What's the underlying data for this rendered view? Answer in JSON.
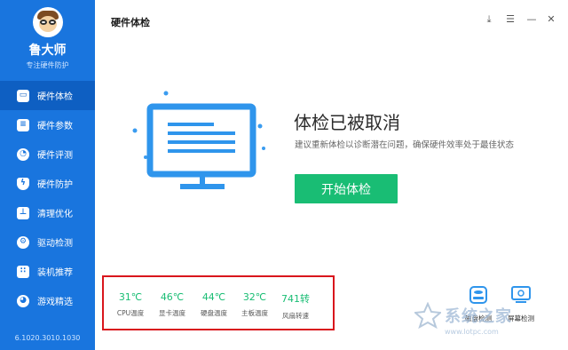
{
  "app": {
    "brand_name": "鲁大师",
    "brand_slogan": "专注硬件防护",
    "version": "6.1020.3010.1030"
  },
  "sidebar": {
    "items": [
      {
        "label": "硬件体检",
        "icon": "monitor-icon",
        "active": true
      },
      {
        "label": "硬件参数",
        "icon": "list-icon"
      },
      {
        "label": "硬件评测",
        "icon": "gauge-icon"
      },
      {
        "label": "硬件防护",
        "icon": "shield-icon"
      },
      {
        "label": "清理优化",
        "icon": "broom-icon"
      },
      {
        "label": "驱动检测",
        "icon": "gear-icon"
      },
      {
        "label": "装机推荐",
        "icon": "cubes-icon"
      },
      {
        "label": "游戏精选",
        "icon": "gamepad-icon"
      }
    ]
  },
  "header": {
    "title": "硬件体检",
    "controls": {
      "download": "⤓",
      "menu": "☰",
      "minimize": "—",
      "close": "✕"
    }
  },
  "result": {
    "title": "体检已被取消",
    "description": "建议重新体检以诊断潜在问题，确保硬件效率处于最佳状态",
    "start_button": "开始体检"
  },
  "temperatures": [
    {
      "value": "31℃",
      "label": "CPU温度"
    },
    {
      "value": "46℃",
      "label": "显卡温度"
    },
    {
      "value": "44℃",
      "label": "硬盘温度"
    },
    {
      "value": "32℃",
      "label": "主板温度"
    },
    {
      "value": "741转",
      "label": "风扇转速"
    }
  ],
  "tools": [
    {
      "label": "磁盘检测",
      "icon": "disk-icon"
    },
    {
      "label": "屏幕检测",
      "icon": "screen-icon"
    }
  ],
  "watermark": {
    "line1": "系统之家",
    "line2": "www.lotpc.com"
  },
  "colors": {
    "sidebar": "#1975de",
    "sidebar_active": "#0e5fc2",
    "accent_green": "#19bd74",
    "highlight_red": "#d9161d"
  }
}
